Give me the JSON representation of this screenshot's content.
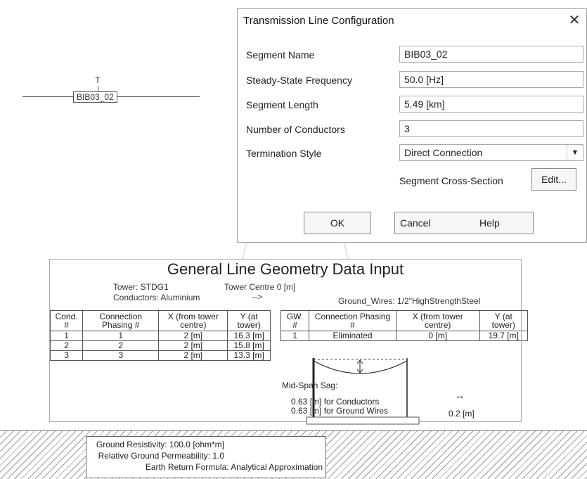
{
  "schematic": {
    "segment_label": "BIB03_02",
    "terminal_label": "T"
  },
  "dialog": {
    "title": "Transmission Line Configuration",
    "close_glyph": "✕",
    "fields": [
      {
        "label": "Segment Name",
        "value": "BIB03_02"
      },
      {
        "label": "Steady-State Frequency",
        "value": "50.0 [Hz]"
      },
      {
        "label": "Segment Length",
        "value": "5.49 [km]"
      },
      {
        "label": "Number of Conductors",
        "value": "3"
      }
    ],
    "termination": {
      "label": "Termination Style",
      "value": "Direct Connection"
    },
    "cross_section": {
      "label": "Segment Cross-Section",
      "button": "Edit..."
    },
    "buttons": {
      "ok": "OK",
      "cancel": "Cancel",
      "help": "Help"
    }
  },
  "geometry": {
    "title": "General Line Geometry Data Input",
    "tower": "Tower: STDG1",
    "conductors": "Conductors: Aluminium",
    "tower_centre": "Tower Centre 0 [m]",
    "tower_centre_arrow": "-->",
    "ground_wires": "Ground_Wires: 1/2\"HighStrengthSteel",
    "cond_headers": [
      "Cond. #",
      "Connection Phasing #",
      "X (from tower centre)",
      "Y (at tower)"
    ],
    "cond_rows": [
      [
        "1",
        "1",
        "2 [m]",
        "16.3 [m]"
      ],
      [
        "2",
        "2",
        "2 [m]",
        "15.8 [m]"
      ],
      [
        "3",
        "3",
        "2 [m]",
        "13.3 [m]"
      ]
    ],
    "gw_headers": [
      "GW. #",
      "Connection Phasing #",
      "X (from tower centre)",
      "Y (at tower)"
    ],
    "gw_rows": [
      [
        "1",
        "Eliminated",
        "0 [m]",
        "19.7 [m]"
      ]
    ],
    "sag_label": "Mid-Span Sag:",
    "sag_conductors": "0.63 [m] for Conductors",
    "sag_ground_wires": "0.63 [m] for Ground Wires",
    "spacing": "0.2 [m]"
  },
  "ground": {
    "resistivity": "Ground Resistivity: 100.0 [ohm*m]",
    "permeability": "Relative Ground Permeability: 1.0",
    "formula": "Earth Return Formula: Analytical Approximation"
  }
}
